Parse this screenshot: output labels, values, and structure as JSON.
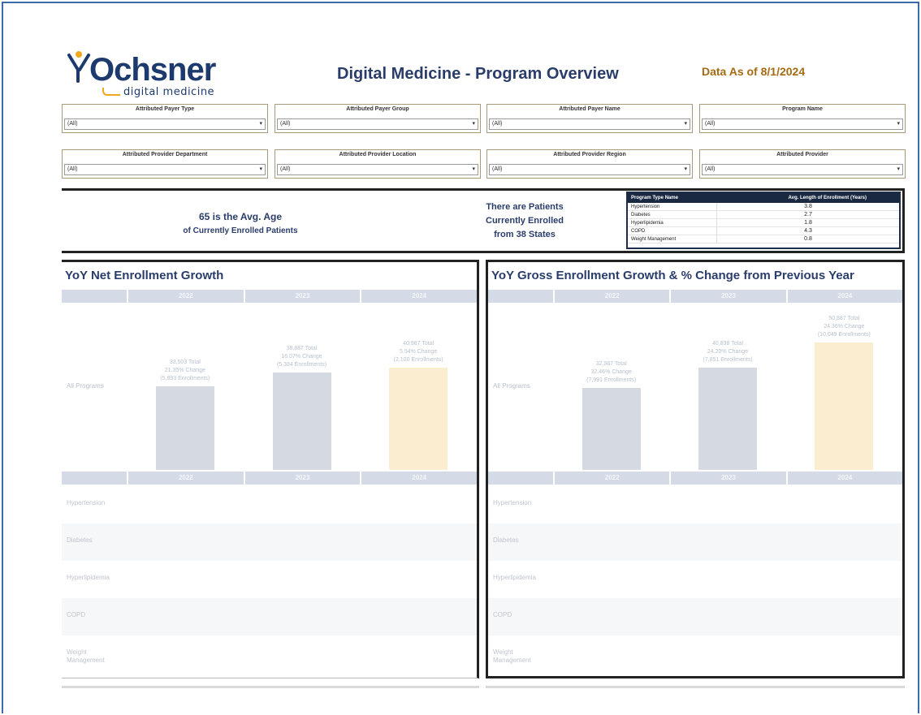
{
  "header": {
    "logo_word": "Ochsner",
    "logo_sub": "digital medicine",
    "title": "Digital Medicine - Program Overview",
    "data_as_of": "Data As of 8/1/2024"
  },
  "filters": [
    {
      "label": "Attributed Payer Type",
      "value": "(All)"
    },
    {
      "label": "Attributed Payer Group",
      "value": "(All)"
    },
    {
      "label": "Attributed Payer Name",
      "value": "(All)"
    },
    {
      "label": "Program Name",
      "value": "(All)"
    },
    {
      "label": "Attributed Provider Department",
      "value": "(All)"
    },
    {
      "label": "Attributed Provider Location",
      "value": "(All)"
    },
    {
      "label": "Attributed Provider Region",
      "value": "(All)"
    },
    {
      "label": "Attributed Provider",
      "value": "(All)"
    }
  ],
  "summary": {
    "avg_age_line1": "65 is the Avg. Age",
    "avg_age_line2": "of Currently Enrolled Patients",
    "states_line1": "There are Patients",
    "states_line2": "Currently Enrolled",
    "states_line3": "from 38 States"
  },
  "los_table": {
    "col1": "Program Type Name",
    "col2": "Avg. Length of Enrollment (Years)",
    "rows": [
      {
        "name": "Hypertension",
        "value": "3.8"
      },
      {
        "name": "Diabetes",
        "value": "2.7"
      },
      {
        "name": "Hyperlipidemia",
        "value": "1.8"
      },
      {
        "name": "COPD",
        "value": "4.3"
      },
      {
        "name": "Weight Management",
        "value": "0.8"
      }
    ]
  },
  "net_panel": {
    "title": "YoY Net Enrollment Growth",
    "years": [
      "2022",
      "2023",
      "2024"
    ],
    "row_label": "All Programs",
    "categories": [
      "Hypertension",
      "Diabetes",
      "Hyperlipidemia",
      "COPD",
      "Weight Management"
    ],
    "bar_labels": [
      [
        "33,503 Total",
        "21.35% Change",
        "(5,893 Enrollments)"
      ],
      [
        "38,887 Total",
        "16.07% Change",
        "(5,384 Enrollments)"
      ],
      [
        "40,987 Total",
        "5.54% Change",
        "(2,100 Enrollments)"
      ]
    ],
    "values": [
      33503,
      38887,
      40987
    ],
    "colors": [
      "#d4d9e2",
      "#d4d9e2",
      "#fbedcf"
    ]
  },
  "gross_panel": {
    "title": "YoY Gross Enrollment Growth & % Change from Previous Year",
    "years": [
      "2022",
      "2023",
      "2024"
    ],
    "row_label": "All Programs",
    "categories": [
      "Hypertension",
      "Diabetes",
      "Hyperlipidemia",
      "COPD",
      "Weight Management"
    ],
    "bar_labels": [
      [
        "32,987 Total",
        "32.46% Change",
        "(7,991 Enrollments)"
      ],
      [
        "40,838 Total",
        "24.20% Change",
        "(7,851 Enrollments)"
      ],
      [
        "50,887 Total",
        "24.36% Change",
        "(10,049 Enrollments)"
      ]
    ],
    "values": [
      32987,
      40838,
      50887
    ],
    "colors": [
      "#d4d9e2",
      "#d4d9e2",
      "#fbedcf"
    ]
  }
}
